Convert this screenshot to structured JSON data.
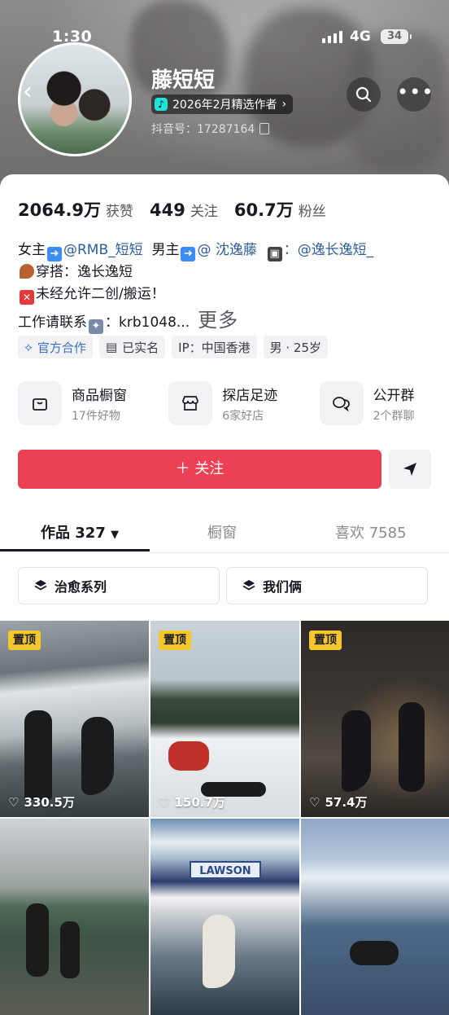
{
  "status_bar": {
    "time": "1:30",
    "network": "4G",
    "battery": "34"
  },
  "profile": {
    "name": "藤短短",
    "badge": "2026年2月精选作者",
    "douyin_id": "抖音号：17287164"
  },
  "stats": [
    {
      "value": "2064.9万",
      "label": "获赞"
    },
    {
      "value": "449",
      "label": "关注"
    },
    {
      "value": "60.7万",
      "label": "粉丝"
    }
  ],
  "bio": {
    "line1_a": "女主",
    "line1_b": "@RMB_短短",
    "line1_c": "男主",
    "line1_d": "@ 沈逸藤",
    "line1_e": "：",
    "line1_f": "@逸长逸短_",
    "line2": "穿搭：逸长逸短",
    "line3": "未经允许二创/搬运！",
    "line4": "工作请联系",
    "line4_b": "：krb1048...",
    "more": "更多"
  },
  "tags": [
    "官方合作",
    "已实名",
    "IP：中国香港",
    "男 · 25岁"
  ],
  "services": [
    {
      "title": "商品橱窗",
      "sub": "17件好物",
      "icon": "shopping-bag-icon"
    },
    {
      "title": "探店足迹",
      "sub": "6家好店",
      "icon": "store-icon"
    },
    {
      "title": "公开群",
      "sub": "2个群聊",
      "icon": "chat-bubbles-icon"
    }
  ],
  "actions": {
    "follow": "＋ 关注"
  },
  "tabs": [
    {
      "label": "作品 327"
    },
    {
      "label": "橱窗"
    },
    {
      "label": "喜欢 7585"
    }
  ],
  "collections": [
    "治愈系列",
    "我们俩"
  ],
  "videos": [
    {
      "pinned": "置顶",
      "likes": "330.5万"
    },
    {
      "pinned": "置顶",
      "likes": "150.7万"
    },
    {
      "pinned": "置顶",
      "likes": "57.4万"
    },
    {
      "pinned": "",
      "likes": ""
    },
    {
      "pinned": "",
      "likes": "",
      "sign": "LAWSON"
    },
    {
      "pinned": "",
      "likes": ""
    }
  ],
  "colors": {
    "follow_button": "#ec4055",
    "pin_badge": "#f6c72a",
    "link": "#2f5d9c"
  }
}
